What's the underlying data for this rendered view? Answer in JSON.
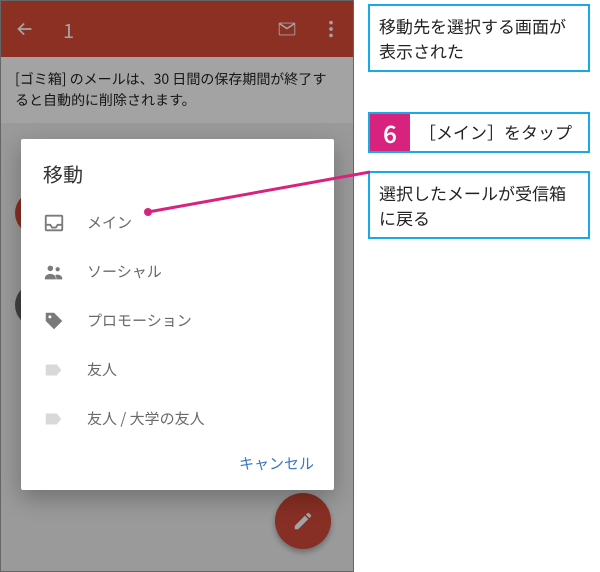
{
  "toolbar": {
    "count": "1"
  },
  "notice": "[ゴミ箱] のメールは、30 日間の保存期間が終了すると自動的に削除されます。",
  "dialog": {
    "title": "移動",
    "items": [
      {
        "label": "メイン"
      },
      {
        "label": "ソーシャル"
      },
      {
        "label": "プロモーション"
      },
      {
        "label": "友人"
      },
      {
        "label": "友人 / 大学の友人"
      }
    ],
    "cancel": "キャンセル"
  },
  "annotations": {
    "a1": "移動先を選択する画面が表示された",
    "step_num": "6",
    "step_text": "［メイン］をタップ",
    "a2": "選択したメールが受信箱に戻る"
  }
}
